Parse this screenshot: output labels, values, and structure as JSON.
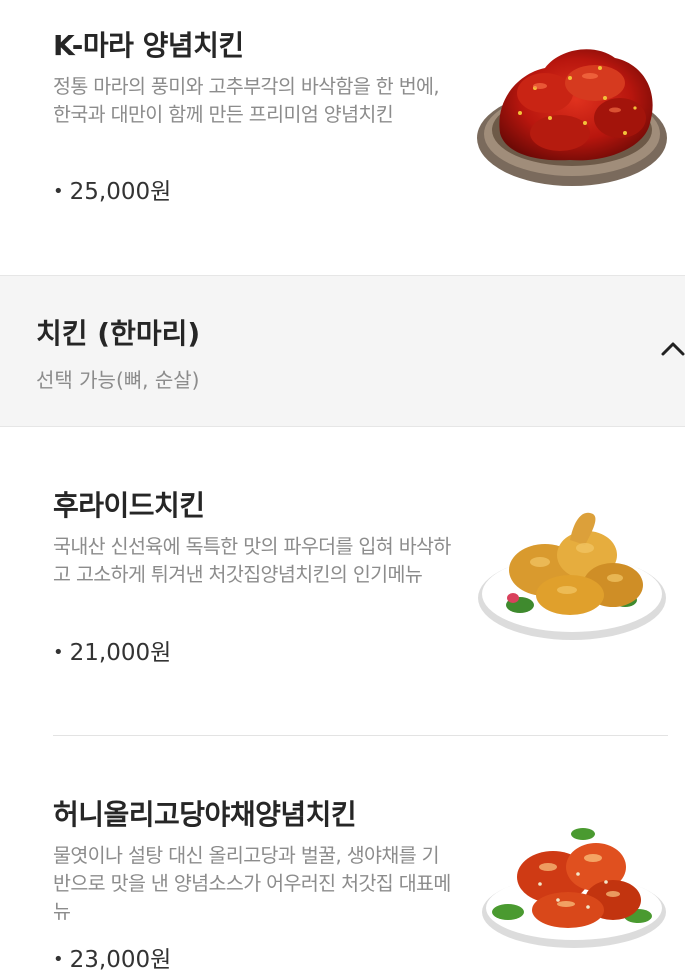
{
  "menu": {
    "items": [
      {
        "name": "K-마라 양념치킨",
        "description": "정통 마라의 풍미와 고추부각의 바삭함을 한 번에, 한국과 대만이 함께 만든 프리미엄 양념치킨",
        "price": "25,000원"
      },
      {
        "name": "후라이드치킨",
        "description": "국내산 신선육에 독특한 맛의 파우더를 입혀 바삭하고 고소하게 튀겨낸 처갓집양념치킨의 인기메뉴",
        "price": "21,000원"
      },
      {
        "name": "허니올리고당야채양념치킨",
        "description": "물엿이나 설탕 대신 올리고당과 벌꿀, 생야채를 기반으로 맛을 낸 양념소스가 어우러진 처갓집 대표메뉴",
        "price": "23,000원"
      }
    ]
  },
  "category": {
    "title": "치킨 (한마리)",
    "subtitle": "선택 가능(뼈, 순살)",
    "toggle_icon": "chevron-up-icon"
  },
  "colors": {
    "background": "#ffffff",
    "category_background": "#f5f5f5",
    "title_text": "#262626",
    "description_text": "#8c8c8c",
    "sauce_red": "#b8160e",
    "fried_gold": "#e0a02c",
    "honey_orange": "#d9481a"
  }
}
